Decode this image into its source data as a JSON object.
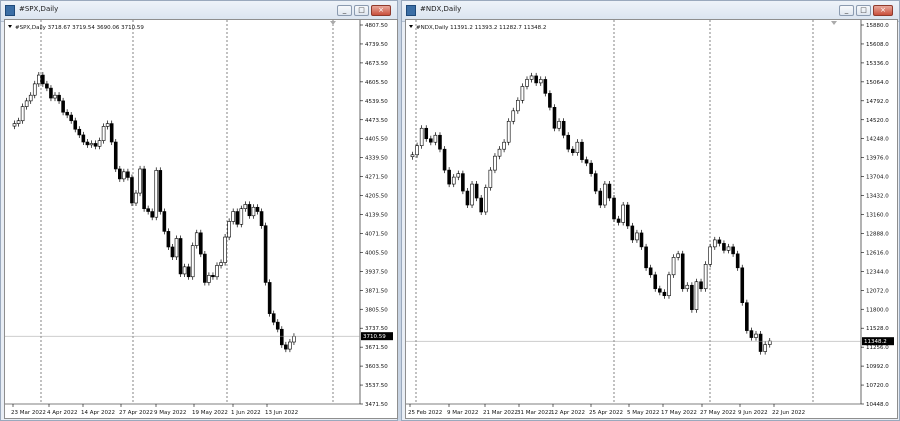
{
  "windows": [
    {
      "title": "#SPX,Daily",
      "info": "#SPX,Daily  3718.67 3719.54 3690.06 3710.59",
      "price_label": "3710.59",
      "y_ticks": [
        "4807.50",
        "4739.50",
        "4673.50",
        "4605.50",
        "4539.50",
        "4473.50",
        "4405.50",
        "4339.50",
        "4271.50",
        "4205.50",
        "4139.50",
        "4071.50",
        "4005.50",
        "3937.50",
        "3871.50",
        "3805.50",
        "3737.50",
        "3671.50",
        "3603.50",
        "3537.50",
        "3471.50"
      ],
      "x_ticks": [
        "23 Mar 2022",
        "4 Apr 2022",
        "14 Apr 2022",
        "27 Apr 2022",
        "9 May 2022",
        "19 May 2022",
        "1 Jun 2022",
        "13 Jun 2022"
      ]
    },
    {
      "title": "#NDX,Daily",
      "info": "#NDX,Daily  11391.2 11393.2 11282.7 11348.2",
      "price_label": "11348.2",
      "y_ticks": [
        "15880.0",
        "15608.0",
        "15336.0",
        "15064.0",
        "14792.0",
        "14520.0",
        "14248.0",
        "13976.0",
        "13704.0",
        "13432.0",
        "13160.0",
        "12888.0",
        "12616.0",
        "12344.0",
        "12072.0",
        "11800.0",
        "11528.0",
        "11256.0",
        "10992.0",
        "10720.0",
        "10448.0"
      ],
      "x_ticks": [
        "25 Feb 2022",
        "9 Mar 2022",
        "21 Mar 2022",
        "31 Mar 2022",
        "12 Apr 2022",
        "25 Apr 2022",
        "5 May 2022",
        "17 May 2022",
        "27 May 2022",
        "9 Jun 2022",
        "22 Jun 2022"
      ]
    }
  ],
  "buttons": {
    "minimize": "_",
    "maximize": "□",
    "close": "×"
  },
  "chart_data": [
    {
      "type": "candlestick",
      "title": "#SPX,Daily",
      "ylim": [
        3471.5,
        4807.5
      ],
      "last_price": 3710.59,
      "closes": [
        4460,
        4470,
        4520,
        4540,
        4560,
        4600,
        4631,
        4600,
        4585,
        4550,
        4560,
        4540,
        4500,
        4490,
        4470,
        4440,
        4420,
        4395,
        4385,
        4390,
        4380,
        4400,
        4450,
        4460,
        4395,
        4300,
        4265,
        4290,
        4270,
        4180,
        4215,
        4300,
        4160,
        4150,
        4130,
        4295,
        4150,
        4080,
        4025,
        3990,
        4055,
        3930,
        3955,
        3920,
        4030,
        4075,
        4000,
        3900,
        3925,
        3920,
        3960,
        3970,
        4060,
        4115,
        4150,
        4105,
        4160,
        4175,
        4135,
        4165,
        4150,
        4100,
        3900,
        3790,
        3760,
        3735,
        3680,
        3665,
        3690,
        3710
      ]
    },
    {
      "type": "candlestick",
      "title": "#NDX,Daily",
      "ylim": [
        10448,
        15880
      ],
      "last_price": 11348.2,
      "closes": [
        14020,
        14150,
        14400,
        14250,
        14200,
        14300,
        14100,
        13800,
        13600,
        13700,
        13750,
        13500,
        13300,
        13600,
        13400,
        13200,
        13550,
        13800,
        14000,
        14100,
        14200,
        14500,
        14650,
        14800,
        15000,
        15100,
        15150,
        15050,
        15100,
        14900,
        14700,
        14400,
        14500,
        14300,
        14100,
        14050,
        14200,
        13950,
        13900,
        13750,
        13500,
        13300,
        13600,
        13400,
        13100,
        13050,
        13300,
        13000,
        12800,
        12900,
        12700,
        12400,
        12300,
        12100,
        12050,
        12000,
        12300,
        12550,
        12600,
        12100,
        12150,
        11800,
        12200,
        12100,
        12450,
        12700,
        12800,
        12750,
        12650,
        12700,
        12600,
        12400,
        11900,
        11500,
        11400,
        11450,
        11200,
        11300,
        11350
      ]
    }
  ]
}
